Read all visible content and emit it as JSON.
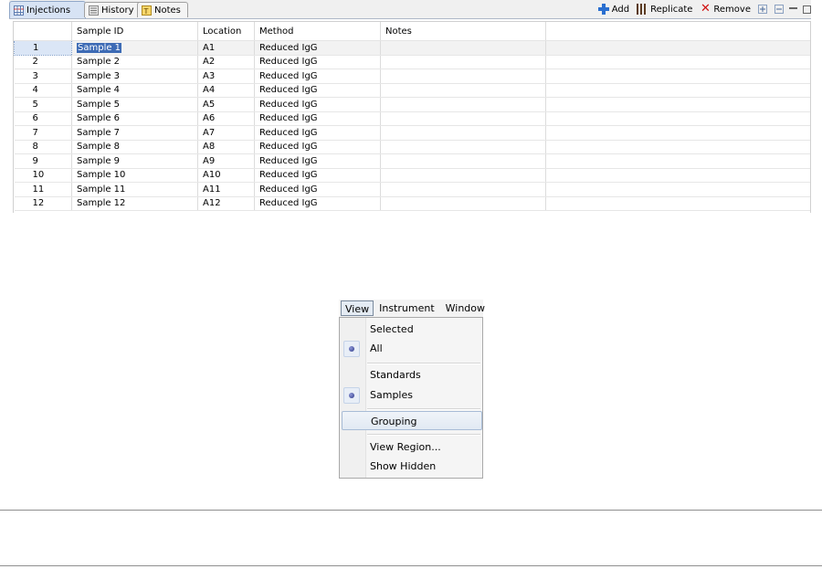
{
  "tabs": [
    {
      "label": "Injections",
      "icon": "table-icon",
      "active": true
    },
    {
      "label": "History",
      "icon": "history-icon",
      "active": false
    },
    {
      "label": "Notes",
      "icon": "notes-icon",
      "active": false
    }
  ],
  "toolbar": {
    "add_label": "Add",
    "replicate_label": "Replicate",
    "remove_label": "Remove"
  },
  "grid": {
    "columns": [
      "",
      "Sample ID",
      "Location",
      "Method",
      "Notes",
      ""
    ],
    "rows": [
      {
        "num": "1",
        "sample_id": "Sample 1",
        "location": "A1",
        "method": "Reduced IgG",
        "notes": ""
      },
      {
        "num": "2",
        "sample_id": "Sample 2",
        "location": "A2",
        "method": "Reduced IgG",
        "notes": ""
      },
      {
        "num": "3",
        "sample_id": "Sample 3",
        "location": "A3",
        "method": "Reduced IgG",
        "notes": ""
      },
      {
        "num": "4",
        "sample_id": "Sample 4",
        "location": "A4",
        "method": "Reduced IgG",
        "notes": ""
      },
      {
        "num": "5",
        "sample_id": "Sample 5",
        "location": "A5",
        "method": "Reduced IgG",
        "notes": ""
      },
      {
        "num": "6",
        "sample_id": "Sample 6",
        "location": "A6",
        "method": "Reduced IgG",
        "notes": ""
      },
      {
        "num": "7",
        "sample_id": "Sample 7",
        "location": "A7",
        "method": "Reduced IgG",
        "notes": ""
      },
      {
        "num": "8",
        "sample_id": "Sample 8",
        "location": "A8",
        "method": "Reduced IgG",
        "notes": ""
      },
      {
        "num": "9",
        "sample_id": "Sample 9",
        "location": "A9",
        "method": "Reduced IgG",
        "notes": ""
      },
      {
        "num": "10",
        "sample_id": "Sample 10",
        "location": "A10",
        "method": "Reduced IgG",
        "notes": ""
      },
      {
        "num": "11",
        "sample_id": "Sample 11",
        "location": "A11",
        "method": "Reduced IgG",
        "notes": ""
      },
      {
        "num": "12",
        "sample_id": "Sample 12",
        "location": "A12",
        "method": "Reduced IgG",
        "notes": ""
      }
    ]
  },
  "menubar": {
    "items": [
      "View",
      "Instrument",
      "Window"
    ],
    "open": "View"
  },
  "view_menu": {
    "items": [
      {
        "label": "Selected",
        "checked": false
      },
      {
        "label": "All",
        "checked": true
      },
      {
        "label": "Standards",
        "checked": false
      },
      {
        "label": "Samples",
        "checked": true
      },
      {
        "label": "Grouping",
        "checked": false,
        "highlighted": true
      },
      {
        "label": "View Region...",
        "checked": false
      },
      {
        "label": "Show Hidden",
        "checked": false
      }
    ]
  },
  "colors": {
    "selection": "#3d6bb5",
    "tab_active": "#d7e3f4",
    "radio_dot": "#2a3585",
    "remove_icon": "#d01010",
    "add_icon": "#2a6fd0"
  }
}
